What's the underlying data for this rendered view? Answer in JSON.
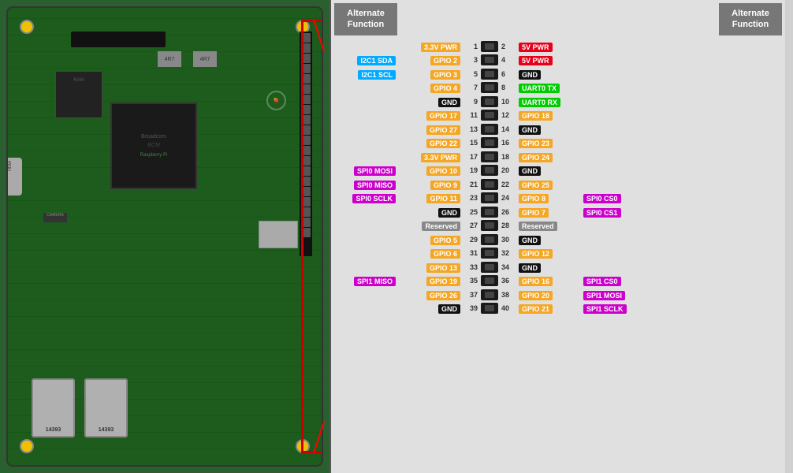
{
  "header": {
    "left_alt_func": "Alternate\nFunction",
    "right_alt_func": "Alternate\nFunction"
  },
  "pins": [
    {
      "left_alt": "",
      "left_alt_color": "",
      "left_name": "3.3V PWR",
      "left_color": "c-3v3",
      "left_num": "1",
      "right_num": "2",
      "right_name": "5V PWR",
      "right_color": "c-5v",
      "right_alt": "",
      "right_alt_color": ""
    },
    {
      "left_alt": "I2C1 SDA",
      "left_alt_color": "c-i2c",
      "left_name": "GPIO 2",
      "left_color": "c-gpio",
      "left_num": "3",
      "right_num": "4",
      "right_name": "5V PWR",
      "right_color": "c-5v",
      "right_alt": "",
      "right_alt_color": ""
    },
    {
      "left_alt": "I2C1 SCL",
      "left_alt_color": "c-i2c",
      "left_name": "GPIO 3",
      "left_color": "c-gpio",
      "left_num": "5",
      "right_num": "6",
      "right_name": "GND",
      "right_color": "c-gnd",
      "right_alt": "",
      "right_alt_color": ""
    },
    {
      "left_alt": "",
      "left_alt_color": "",
      "left_name": "GPIO 4",
      "left_color": "c-gpio",
      "left_num": "7",
      "right_num": "8",
      "right_name": "UART0 TX",
      "right_color": "c-uart",
      "right_alt": "",
      "right_alt_color": ""
    },
    {
      "left_alt": "",
      "left_alt_color": "",
      "left_name": "GND",
      "left_color": "c-gnd",
      "left_num": "9",
      "right_num": "10",
      "right_name": "UART0 RX",
      "right_color": "c-uart",
      "right_alt": "",
      "right_alt_color": ""
    },
    {
      "left_alt": "",
      "left_alt_color": "",
      "left_name": "GPIO 17",
      "left_color": "c-gpio",
      "left_num": "11",
      "right_num": "12",
      "right_name": "GPIO 18",
      "right_color": "c-gpio",
      "right_alt": "",
      "right_alt_color": ""
    },
    {
      "left_alt": "",
      "left_alt_color": "",
      "left_name": "GPIO 27",
      "left_color": "c-gpio",
      "left_num": "13",
      "right_num": "14",
      "right_name": "GND",
      "right_color": "c-gnd",
      "right_alt": "",
      "right_alt_color": ""
    },
    {
      "left_alt": "",
      "left_alt_color": "",
      "left_name": "GPIO 22",
      "left_color": "c-gpio",
      "left_num": "15",
      "right_num": "16",
      "right_name": "GPIO 23",
      "right_color": "c-gpio",
      "right_alt": "",
      "right_alt_color": ""
    },
    {
      "left_alt": "",
      "left_alt_color": "",
      "left_name": "3.3V PWR",
      "left_color": "c-3v3",
      "left_num": "17",
      "right_num": "18",
      "right_name": "GPIO 24",
      "right_color": "c-gpio",
      "right_alt": "",
      "right_alt_color": ""
    },
    {
      "left_alt": "SPI0 MOSI",
      "left_alt_color": "c-spi",
      "left_name": "GPIO 10",
      "left_color": "c-gpio",
      "left_num": "19",
      "right_num": "20",
      "right_name": "GND",
      "right_color": "c-gnd",
      "right_alt": "",
      "right_alt_color": ""
    },
    {
      "left_alt": "SPI0 MISO",
      "left_alt_color": "c-spi",
      "left_name": "GPIO 9",
      "left_color": "c-gpio",
      "left_num": "21",
      "right_num": "22",
      "right_name": "GPIO 25",
      "right_color": "c-gpio",
      "right_alt": "",
      "right_alt_color": ""
    },
    {
      "left_alt": "SPI0 SCLK",
      "left_alt_color": "c-spi",
      "left_name": "GPIO 11",
      "left_color": "c-gpio",
      "left_num": "23",
      "right_num": "24",
      "right_name": "GPIO 8",
      "right_color": "c-gpio",
      "right_alt": "SPI0 CS0",
      "right_alt_color": "c-spi"
    },
    {
      "left_alt": "",
      "left_alt_color": "",
      "left_name": "GND",
      "left_color": "c-gnd",
      "left_num": "25",
      "right_num": "26",
      "right_name": "GPIO 7",
      "right_color": "c-gpio",
      "right_alt": "SPI0 CS1",
      "right_alt_color": "c-spi"
    },
    {
      "left_alt": "",
      "left_alt_color": "",
      "left_name": "Reserved",
      "left_color": "c-reserved",
      "left_num": "27",
      "right_num": "28",
      "right_name": "Reserved",
      "right_color": "c-reserved",
      "right_alt": "",
      "right_alt_color": ""
    },
    {
      "left_alt": "",
      "left_alt_color": "",
      "left_name": "GPIO 5",
      "left_color": "c-gpio",
      "left_num": "29",
      "right_num": "30",
      "right_name": "GND",
      "right_color": "c-gnd",
      "right_alt": "",
      "right_alt_color": ""
    },
    {
      "left_alt": "",
      "left_alt_color": "",
      "left_name": "GPIO 6",
      "left_color": "c-gpio",
      "left_num": "31",
      "right_num": "32",
      "right_name": "GPIO 12",
      "right_color": "c-gpio",
      "right_alt": "",
      "right_alt_color": ""
    },
    {
      "left_alt": "",
      "left_alt_color": "",
      "left_name": "GPIO 13",
      "left_color": "c-gpio",
      "left_num": "33",
      "right_num": "34",
      "right_name": "GND",
      "right_color": "c-gnd",
      "right_alt": "",
      "right_alt_color": ""
    },
    {
      "left_alt": "SPI1 MISO",
      "left_alt_color": "c-spi",
      "left_name": "GPIO 19",
      "left_color": "c-gpio",
      "left_num": "35",
      "right_num": "36",
      "right_name": "GPIO 16",
      "right_color": "c-gpio",
      "right_alt": "SPI1 CS0",
      "right_alt_color": "c-spi"
    },
    {
      "left_alt": "",
      "left_alt_color": "",
      "left_name": "GPIO 26",
      "left_color": "c-gpio",
      "left_num": "37",
      "right_num": "38",
      "right_name": "GPIO 20",
      "right_color": "c-gpio",
      "right_alt": "SPI1 MOSI",
      "right_alt_color": "c-spi"
    },
    {
      "left_alt": "",
      "left_alt_color": "",
      "left_name": "GND",
      "left_color": "c-gnd",
      "left_num": "39",
      "right_num": "40",
      "right_name": "GPIO 21",
      "right_color": "c-gpio",
      "right_alt": "SPI1 SCLK",
      "right_alt_color": "c-spi"
    }
  ]
}
